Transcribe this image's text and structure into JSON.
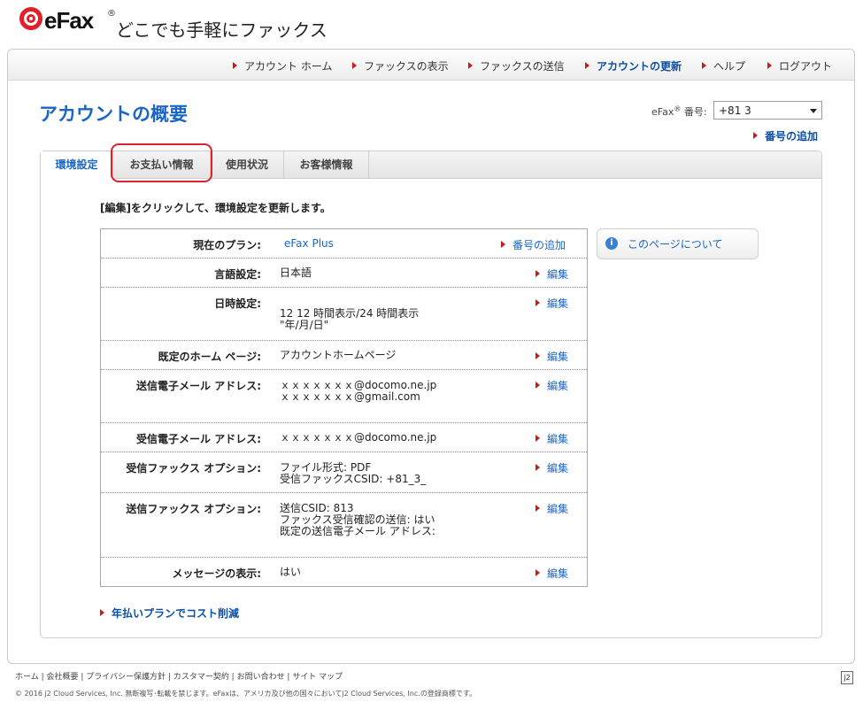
{
  "header": {
    "logo_text": "eFax",
    "logo_reg": "®",
    "tagline": "どこでも手軽にファックス"
  },
  "nav": {
    "items": [
      {
        "label": "アカウント ホーム"
      },
      {
        "label": "ファックスの表示"
      },
      {
        "label": "ファックスの送信"
      },
      {
        "label": "アカウントの更新"
      },
      {
        "label": "ヘルプ"
      },
      {
        "label": "ログアウト"
      }
    ],
    "active_index": 3
  },
  "page": {
    "title": "アカウントの概要",
    "efax_number_label": "eFax",
    "efax_number_reg": "®",
    "efax_number_suffix": " 番号:",
    "efax_number_value": "+81 3",
    "add_number_link": "番号の追加"
  },
  "tabs": [
    {
      "label": "環境設定"
    },
    {
      "label": "お支払い情報"
    },
    {
      "label": "使用状況"
    },
    {
      "label": "お客様情報"
    }
  ],
  "instruction": "[編集]をクリックして、環境設定を更新します。",
  "settings": {
    "plan": {
      "label": "現在のプラン:",
      "value": "eFax Plus",
      "action": "番号の追加"
    },
    "language": {
      "label": "言語設定:",
      "value": "日本語",
      "action": "編集"
    },
    "datetime": {
      "label": "日時設定:",
      "value_line1": "12 12 時間表示/24 時間表示",
      "value_line2": "\"年/月/日\"",
      "action": "編集"
    },
    "homepage": {
      "label": "既定のホーム ページ:",
      "value": "アカウントホームページ",
      "action": "編集"
    },
    "send_email": {
      "label": "送信電子メール アドレス:",
      "value_line1": "ｘｘｘｘｘｘｘ@docomo.ne.jp",
      "value_line2": "ｘｘｘｘｘｘｘ@gmail.com",
      "action": "編集"
    },
    "recv_email": {
      "label": "受信電子メール アドレス:",
      "value": "ｘｘｘｘｘｘｘ@docomo.ne.jp",
      "action": "編集"
    },
    "recv_fax": {
      "label": "受信ファックス オプション:",
      "value_line1": "ファイル形式: PDF",
      "value_line2": "受信ファックスCSID: +81_3_",
      "action": "編集"
    },
    "send_fax": {
      "label": "送信ファックス オプション:",
      "value_line1": "送信CSID: 813",
      "value_line2": "ファックス受信確認の送信: はい",
      "value_line3": "既定の送信電子メール アドレス:",
      "action": "編集"
    },
    "messages": {
      "label": "メッセージの表示:",
      "value": "はい",
      "action": "編集"
    }
  },
  "info_box": {
    "label": "このページについて",
    "icon": "info-icon"
  },
  "cost_link": "年払いプランでコスト削減",
  "footer": {
    "links": "ホーム | 会社概要 | プライバシー保護方針 | カスタマー契約 | お問い合わせ | サイト マップ",
    "copyright": "© 2016 j2 Cloud Services, Inc. 無断複写･転載を禁じます。eFaxは、アメリカ及び他の国々においてj2 Cloud Services, Inc.の登録商標です。"
  },
  "colors": {
    "accent": "#1a66c8",
    "brand_red": "#e0212a"
  }
}
